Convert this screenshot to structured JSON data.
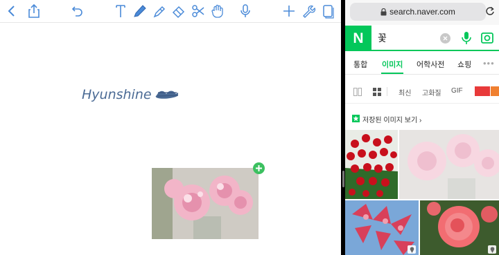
{
  "notes_app": {
    "toolbar": {
      "back": "back-icon",
      "share": "share-icon",
      "undo": "undo-icon",
      "tools": [
        "text-tool-icon",
        "pen-tool-icon",
        "highlighter-tool-icon",
        "eraser-tool-icon",
        "scissors-tool-icon",
        "hand-tool-icon"
      ],
      "mic": "microphone-icon",
      "add": "plus-icon",
      "settings": "wrench-icon",
      "pages": "page-icon"
    },
    "handwriting_text": "Hyunshine",
    "accent_ink": "#4a6a94",
    "pasted_image": "pink-carnation-photo"
  },
  "browser": {
    "url": "search.naver.com",
    "lock": "lock-icon",
    "reload": "reload-icon"
  },
  "naver": {
    "logo": "N",
    "query": "꽃",
    "brand_color": "#03c75a",
    "tabs": [
      {
        "label": "통합",
        "active": false
      },
      {
        "label": "이미지",
        "active": true
      },
      {
        "label": "어학사전",
        "active": false
      },
      {
        "label": "쇼핑",
        "active": false
      }
    ],
    "more": "•••",
    "filters": {
      "labels": [
        "최신",
        "고화질",
        "GIF"
      ],
      "colors": [
        "#e83a3a",
        "#f08030"
      ]
    },
    "saved_images_label": "저장된 이미지 보기",
    "saved_images_chevron": "›",
    "results": [
      "red-rose-bouquet",
      "pink-carnation",
      "pink-lily",
      "pink-rose"
    ]
  }
}
